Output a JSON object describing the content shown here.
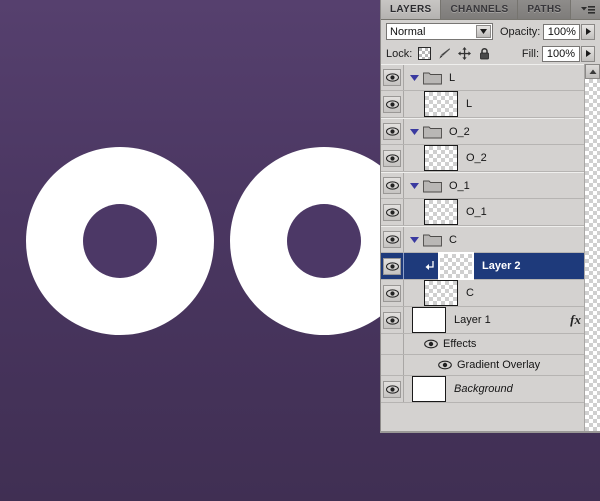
{
  "canvas": {
    "background_gradient_top": "#56406e",
    "background_gradient_bottom": "#402f53",
    "shape_color": "#ffffff",
    "shapes": [
      {
        "name": "ring-1",
        "type": "ring"
      },
      {
        "name": "ring-2",
        "type": "ring"
      }
    ]
  },
  "panel": {
    "tabs": [
      {
        "label": "LAYERS",
        "active": true
      },
      {
        "label": "CHANNELS",
        "active": false
      },
      {
        "label": "PATHS",
        "active": false
      }
    ],
    "menu_icon": "panel-menu-icon",
    "blend_mode": {
      "value": "Normal",
      "arrow_icon": "chevron-down-icon"
    },
    "opacity": {
      "label": "Opacity:",
      "value": "100%",
      "stepper_icon": "stepper-arrow-icon"
    },
    "fill": {
      "label": "Fill:",
      "value": "100%",
      "stepper_icon": "stepper-arrow-icon"
    },
    "lock": {
      "label": "Lock:",
      "icons": [
        "lock-transparency-icon",
        "lock-image-icon",
        "lock-position-icon",
        "lock-all-icon"
      ]
    },
    "scrollbar": {
      "up_arrow_icon": "scroll-up-icon"
    }
  },
  "layers": [
    {
      "name": "L",
      "kind": "group",
      "visible": true,
      "expanded": true,
      "selected": false,
      "thumb": "folder",
      "indent": 0
    },
    {
      "name": "L",
      "kind": "layer",
      "visible": true,
      "selected": false,
      "thumb": "transparent",
      "indent": 1
    },
    {
      "name": "O_2",
      "kind": "group",
      "visible": true,
      "expanded": true,
      "selected": false,
      "thumb": "folder",
      "indent": 0
    },
    {
      "name": "O_2",
      "kind": "layer",
      "visible": true,
      "selected": false,
      "thumb": "transparent",
      "indent": 1
    },
    {
      "name": "O_1",
      "kind": "group",
      "visible": true,
      "expanded": true,
      "selected": false,
      "thumb": "folder",
      "indent": 0
    },
    {
      "name": "O_1",
      "kind": "layer",
      "visible": true,
      "selected": false,
      "thumb": "transparent",
      "indent": 1
    },
    {
      "name": "C",
      "kind": "group",
      "visible": true,
      "expanded": true,
      "selected": false,
      "thumb": "folder",
      "indent": 0
    },
    {
      "name": "Layer 2",
      "kind": "layer",
      "visible": true,
      "selected": true,
      "clipped": true,
      "thumb": "transparent",
      "indent": 1
    },
    {
      "name": "C",
      "kind": "layer",
      "visible": true,
      "selected": false,
      "thumb": "transparent",
      "indent": 1
    },
    {
      "name": "Layer 1",
      "kind": "layer",
      "visible": true,
      "selected": false,
      "thumb": "white",
      "indent": 0,
      "has_fx": true,
      "fx_label": "fx",
      "fx_collapse_icon": "triangle-up-icon"
    },
    {
      "name": "Background",
      "kind": "layer",
      "visible": true,
      "selected": false,
      "thumb": "white",
      "indent": 0,
      "italic": true,
      "locked": true,
      "lock_icon": "lock-icon"
    }
  ],
  "effects": {
    "group_label": "Effects",
    "items": [
      {
        "label": "Gradient Overlay",
        "visible": true
      }
    ]
  },
  "colors": {
    "panel_bg": "#d4d2d0",
    "selection_blue": "#1e3a7b",
    "tab_active": "#c8c6c4"
  }
}
